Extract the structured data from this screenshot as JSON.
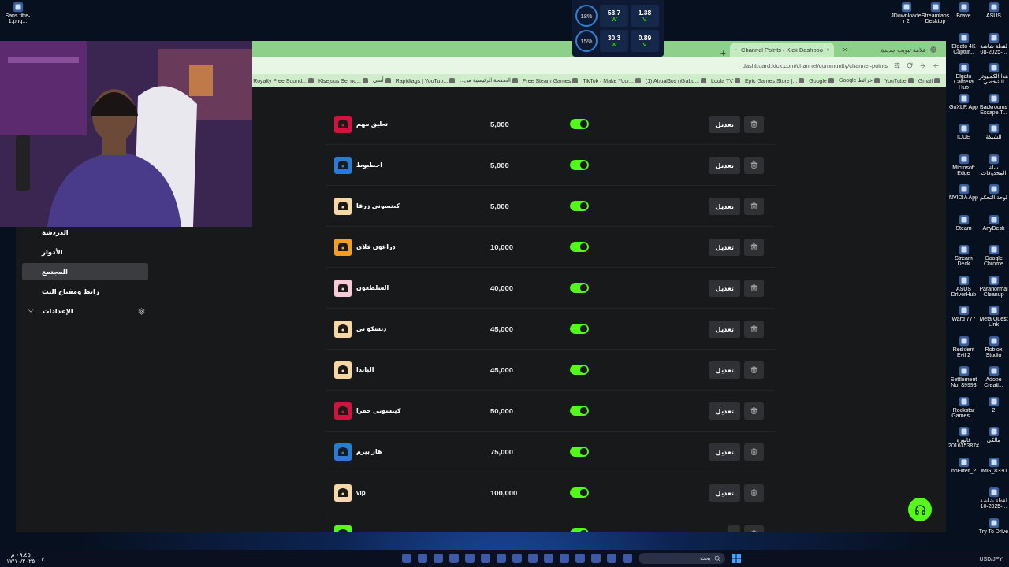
{
  "desktop": {
    "top_left_icon": {
      "label": "Sans titre-1.png..."
    },
    "columns": [
      {
        "icons": [
          {
            "label": "ASUS"
          },
          {
            "label": "لقطة شاشة 2025-08-..."
          },
          {
            "label": "هذا الكمبيوتر الشخصي"
          },
          {
            "label": "Backrooms Escape T..."
          },
          {
            "label": "الشبكة"
          },
          {
            "label": "سلة المحذوفات"
          },
          {
            "label": "لوحة التحكم"
          },
          {
            "label": "AnyDesk"
          },
          {
            "label": "Google Chrome"
          },
          {
            "label": "Paranormal Cleanup"
          },
          {
            "label": "Meta Quest Link"
          },
          {
            "label": "Roblox Studio"
          },
          {
            "label": "Adobe Creati..."
          },
          {
            "label": "2"
          },
          {
            "label": "مالكي"
          },
          {
            "label": "IMG_8330"
          },
          {
            "label": "لقطة شاشة 2025-10-..."
          },
          {
            "label": "Try To Drive"
          }
        ]
      },
      {
        "icons": [
          {
            "label": "Brave"
          },
          {
            "label": "Elgato 4K Captur..."
          },
          {
            "label": "Elgato Camera Hub"
          },
          {
            "label": "GoXLR App"
          },
          {
            "label": "iCUE"
          },
          {
            "label": "Microsoft Edge"
          },
          {
            "label": "NVIDIA App"
          },
          {
            "label": "Steam"
          },
          {
            "label": "Stream Deck"
          },
          {
            "label": "ASUS DriverHub"
          },
          {
            "label": "Ward 777"
          },
          {
            "label": "Resident Evil 2"
          },
          {
            "label": "Settlement No. 89993"
          },
          {
            "label": "Rockstar Games ..."
          },
          {
            "label": "فاتورة #201635387"
          },
          {
            "label": "noFilter_2"
          }
        ]
      },
      {
        "icons": [
          {
            "label": "Streamlabs Desktop"
          }
        ]
      },
      {
        "icons": [
          {
            "label": "JDownloader 2"
          }
        ]
      }
    ]
  },
  "performance_overlay": {
    "rows": [
      {
        "usage": "18%",
        "power": "53.7",
        "power_unit": "W",
        "voltage": "1.38",
        "voltage_unit": "V"
      },
      {
        "usage": "15%",
        "power": "30.3",
        "power_unit": "W",
        "voltage": "0.89",
        "voltage_unit": "V"
      }
    ]
  },
  "browser": {
    "tabs": [
      {
        "title": "علامة تبويب جديدة",
        "selected": false
      },
      {
        "title": "Channel Points - Kick Dashboo",
        "selected": true
      }
    ],
    "address": "dashboard.kick.com/channel/community/channel-points",
    "bookmarks": [
      {
        "label": "Gmail"
      },
      {
        "label": "YouTube"
      },
      {
        "label": "Google خرائط"
      },
      {
        "label": "Google"
      },
      {
        "label": "Epic Games Store |..."
      },
      {
        "label": "Loola TV"
      },
      {
        "label": "(1) Abual3os (@abu..."
      },
      {
        "label": "TikTok - Make Your..."
      },
      {
        "label": "Free Steam Games"
      },
      {
        "label": "الصفحة الرئيسية من..."
      },
      {
        "label": "Rapidtags | YouTub..."
      },
      {
        "label": "أسي"
      },
      {
        "label": "Kisejuus Sei no..."
      },
      {
        "label": "Royalty Free Sound..."
      }
    ]
  },
  "sidebar": {
    "items": [
      {
        "label": "الدردشة",
        "kind": "link",
        "selected": false
      },
      {
        "label": "الأدوار",
        "kind": "link",
        "selected": false
      },
      {
        "label": "المجتمع",
        "kind": "link",
        "selected": true
      },
      {
        "label": "رابط ومفتاح البث",
        "kind": "link",
        "selected": false
      },
      {
        "label": "الإعدادات",
        "kind": "group",
        "selected": false,
        "expanded": false
      }
    ]
  },
  "rewards": [
    {
      "name": "تعليق مهم",
      "cost": "5,000",
      "enabled": true,
      "color": "#d4123e",
      "edit_label": "تعديل"
    },
    {
      "name": "اخطبوط",
      "cost": "5,000",
      "enabled": true,
      "color": "#2a7ad8",
      "edit_label": "تعديل"
    },
    {
      "name": "كيتسوني زرقا",
      "cost": "5,000",
      "enabled": true,
      "color": "#f8d7a4",
      "edit_label": "تعديل"
    },
    {
      "name": "دراغون فلاي",
      "cost": "10,000",
      "enabled": true,
      "color": "#f2a020",
      "edit_label": "تعديل"
    },
    {
      "name": "السلطعون",
      "cost": "40,000",
      "enabled": true,
      "color": "#f7cad6",
      "edit_label": "تعديل"
    },
    {
      "name": "ديسكو بي",
      "cost": "45,000",
      "enabled": true,
      "color": "#f8d7a4",
      "edit_label": "تعديل"
    },
    {
      "name": "الباندا",
      "cost": "45,000",
      "enabled": true,
      "color": "#f8d7a4",
      "edit_label": "تعديل"
    },
    {
      "name": "كيتسوني حمرا",
      "cost": "50,000",
      "enabled": true,
      "color": "#d4123e",
      "edit_label": "تعديل"
    },
    {
      "name": "هاز بيرم",
      "cost": "75,000",
      "enabled": true,
      "color": "#2a7ad8",
      "edit_label": "تعديل"
    },
    {
      "name": "vip",
      "cost": "100,000",
      "enabled": true,
      "color": "#f8d7a4",
      "edit_label": "تعديل"
    },
    {
      "enabled": true,
      "color": "#53fc18"
    }
  ],
  "taskbar": {
    "time": "٠٩:٤٥ م",
    "date": "١٧/١٠/٢٠٢٥",
    "language": "ع",
    "search_placeholder": "بحث",
    "ticker": "USD/JPY"
  }
}
